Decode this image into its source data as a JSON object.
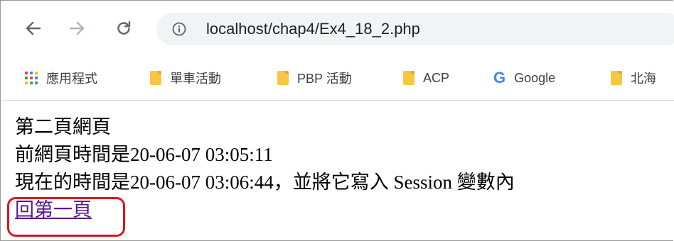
{
  "browser": {
    "url": "localhost/chap4/Ex4_18_2.php",
    "icons": {
      "back": "arrow-left-icon",
      "forward": "arrow-right-icon",
      "reload": "reload-icon",
      "site_info": "info-icon"
    },
    "bookmarks": [
      {
        "label": "應用程式",
        "icon": "apps-grid-icon"
      },
      {
        "label": "單車活動",
        "icon": "folder-icon"
      },
      {
        "label": "PBP 活動",
        "icon": "folder-icon"
      },
      {
        "label": "ACP",
        "icon": "folder-icon"
      },
      {
        "label": "Google",
        "icon": "google-icon"
      },
      {
        "label": "北海",
        "icon": "folder-icon"
      }
    ]
  },
  "page": {
    "heading": "第二頁網頁",
    "previous_time": "前網頁時間是20-06-07 03:05:11",
    "current_time": "現在的時間是20-06-07 03:06:44，並將它寫入 Session 變數內",
    "back_link": "回第一頁"
  },
  "colors": {
    "link": "#551a8b",
    "annotation": "#e0141c",
    "folder": "#f7c643",
    "omnibox": "#f1f3f4"
  }
}
